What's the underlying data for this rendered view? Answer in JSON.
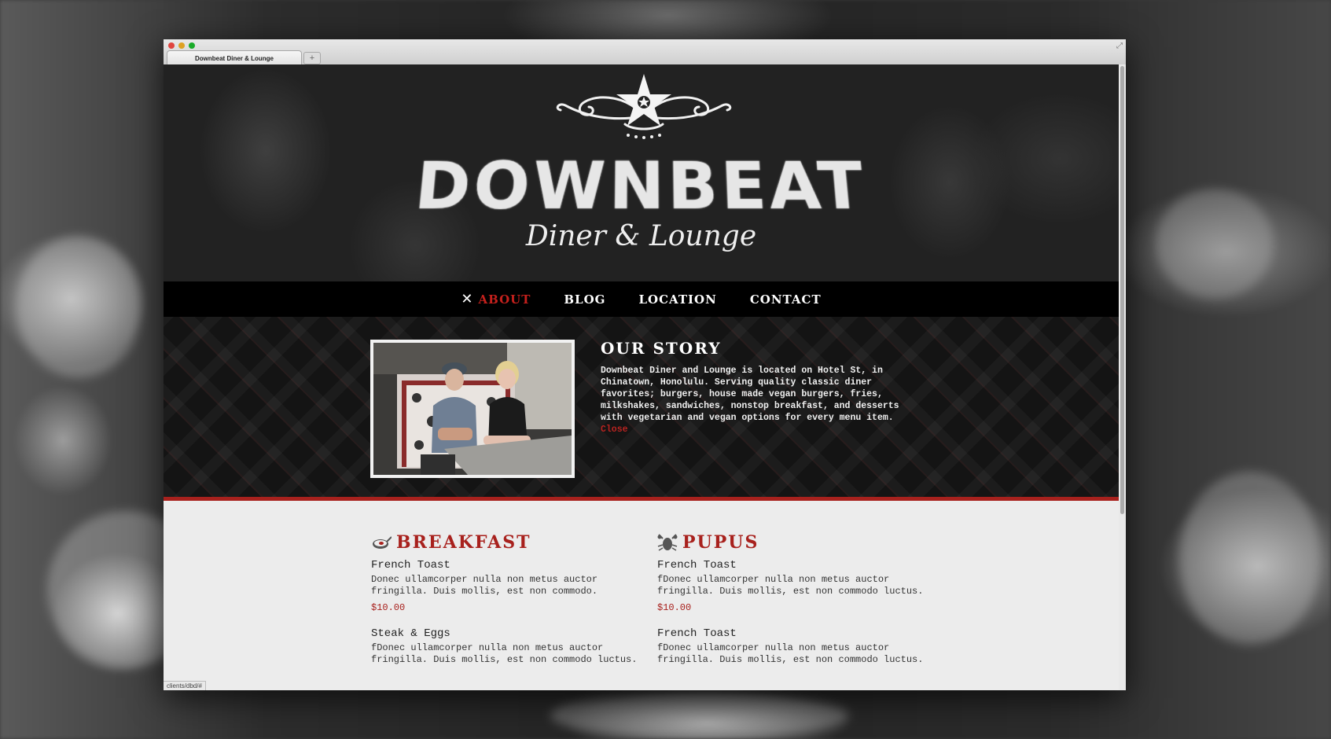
{
  "browser": {
    "tab_title": "Downbeat Diner & Lounge",
    "new_tab_label": "+",
    "status_url": "clients/dbd/#"
  },
  "header": {
    "brand": "DOWNBEAT",
    "tagline": "Diner & Lounge"
  },
  "nav": {
    "items": [
      {
        "label": "ABOUT",
        "active": true
      },
      {
        "label": "BLOG"
      },
      {
        "label": "LOCATION"
      },
      {
        "label": "CONTACT"
      }
    ]
  },
  "story": {
    "title": "OUR STORY",
    "body": "Downbeat Diner and Lounge is located on Hotel St, in Chinatown, Honolulu. Serving quality classic diner favorites; burgers, house made vegan burgers, fries, milkshakes, sandwiches, nonstop breakfast, and desserts with vegetarian and vegan options for every menu item.",
    "close_label": "Close"
  },
  "menu": {
    "breakfast": {
      "title": "BREAKFAST",
      "icon": "skillet-icon",
      "items": [
        {
          "name": "French Toast",
          "desc": "Donec ullamcorper nulla non metus auctor fringilla. Duis mollis, est non commodo.",
          "price": "$10.00"
        },
        {
          "name": "Steak & Eggs",
          "desc": "fDonec ullamcorper nulla non metus auctor fringilla. Duis mollis, est non commodo luctus."
        }
      ]
    },
    "pupus": {
      "title": "PUPUS",
      "icon": "lobster-icon",
      "items": [
        {
          "name": "French Toast",
          "desc": "fDonec ullamcorper nulla non metus auctor fringilla. Duis mollis, est non commodo luctus.",
          "price": "$10.00"
        },
        {
          "name": "French Toast",
          "desc": "fDonec ullamcorper nulla non metus auctor fringilla. Duis mollis, est non commodo luctus."
        }
      ]
    }
  },
  "colors": {
    "accent_red": "#a8211d",
    "nav_bg": "#000000",
    "menu_bg": "#ececec"
  }
}
